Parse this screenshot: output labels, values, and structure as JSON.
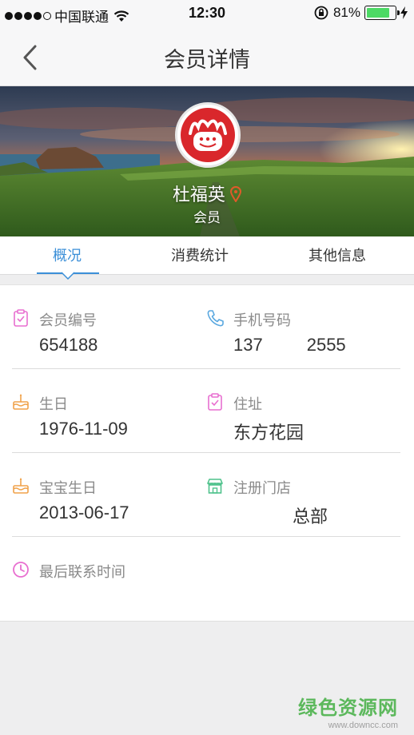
{
  "status_bar": {
    "carrier": "中国联通",
    "time": "12:30",
    "battery": "81%",
    "battery_level": 0.81
  },
  "nav": {
    "title": "会员详情",
    "back_icon": "chevron-left-icon"
  },
  "profile": {
    "name": "杜福英",
    "level": "会员",
    "avatar_icon": "avatar-face-icon",
    "location_icon": "location-pin-icon"
  },
  "tabs": [
    {
      "label": "概况",
      "active": true
    },
    {
      "label": "消费统计",
      "active": false
    },
    {
      "label": "其他信息",
      "active": false
    }
  ],
  "info": {
    "member_no": {
      "label": "会员编号",
      "value": "654188",
      "icon": "clipboard-icon"
    },
    "phone": {
      "label": "手机号码",
      "value": "137         2555",
      "icon": "phone-icon"
    },
    "birthday": {
      "label": "生日",
      "value": "1976-11-09",
      "icon": "cake-icon"
    },
    "address": {
      "label": "住址",
      "value": "东方花园",
      "icon": "clipboard-icon"
    },
    "baby_birthday": {
      "label": "宝宝生日",
      "value": "2013-06-17",
      "icon": "cake-icon"
    },
    "store": {
      "label": "注册门店",
      "value": "总部",
      "icon": "store-icon"
    },
    "last_contact": {
      "label": "最后联系时间",
      "value": "",
      "icon": "clock-icon"
    }
  },
  "watermark": {
    "title": "绿色资源网",
    "url": "www.downcc.com"
  },
  "colors": {
    "accent": "#3b8fd8",
    "pink_icon": "#e86fd0",
    "orange_icon": "#f0a24a",
    "blue_icon": "#5aa8e0",
    "green_icon": "#4fc28c",
    "avatar_red": "#d9272c"
  }
}
